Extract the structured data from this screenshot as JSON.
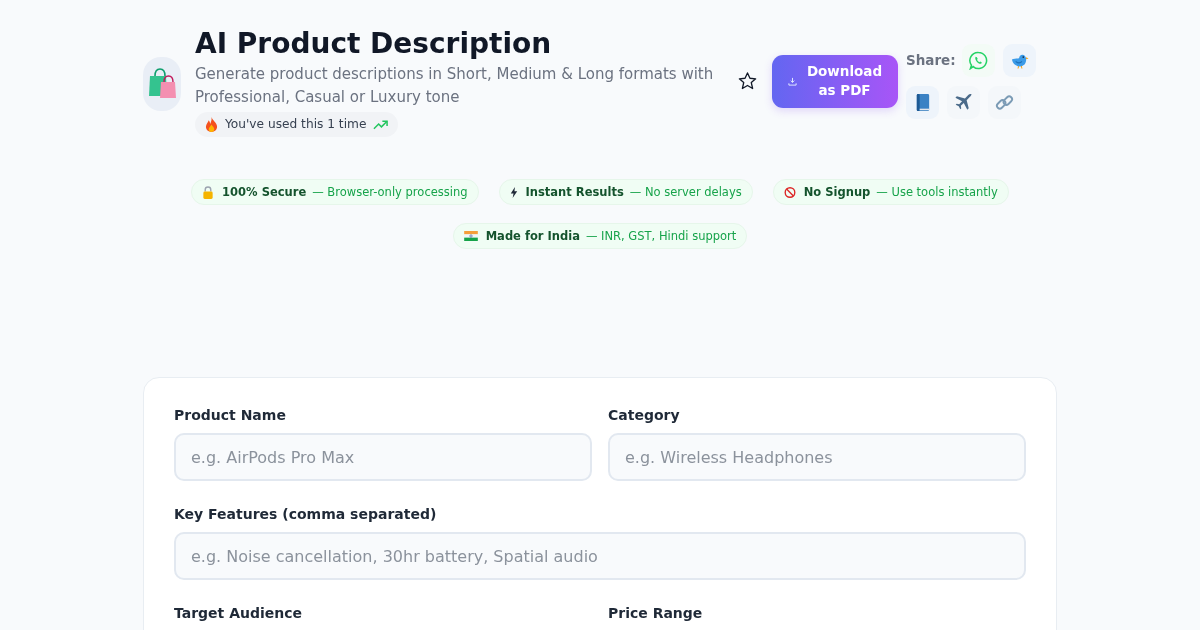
{
  "header": {
    "title": "AI Product Description",
    "subtitle": "Generate product descriptions in Short, Medium & Long formats with Professional, Casual or Luxury tone",
    "usage": "You've used this 1 time",
    "favorite": false,
    "download_button": "Download as PDF",
    "share_label": "Share:"
  },
  "trust_badges": [
    {
      "title": "100% Secure",
      "detail": "— Browser-only processing"
    },
    {
      "title": "Instant Results",
      "detail": "— No server delays"
    },
    {
      "title": "No Signup",
      "detail": "— Use tools instantly"
    },
    {
      "title": "Made for India",
      "detail": "— INR, GST, Hindi support"
    }
  ],
  "form": {
    "rows": [
      [
        {
          "label": "Product Name",
          "placeholder": "e.g. AirPods Pro Max"
        },
        {
          "label": "Category",
          "placeholder": "e.g. Wireless Headphones"
        }
      ],
      [
        {
          "label": "Key Features (comma separated)",
          "placeholder": "e.g. Noise cancellation, 30hr battery, Spatial audio"
        }
      ],
      [
        {
          "label": "Target Audience"
        },
        {
          "label": "Price Range"
        }
      ]
    ]
  }
}
